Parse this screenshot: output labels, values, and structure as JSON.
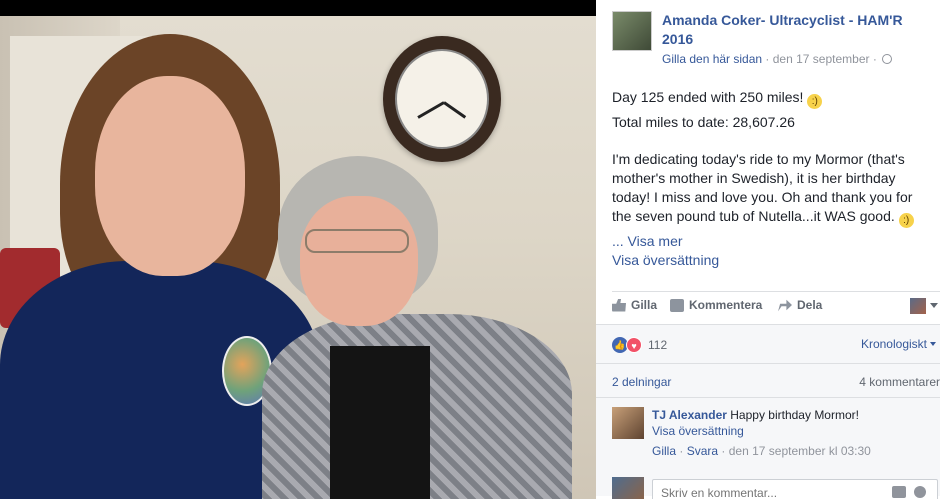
{
  "post": {
    "author": "Amanda Coker- Ultracyclist - HAM'R 2016",
    "like_page": "Gilla den här sidan",
    "date": "den 17 september",
    "separator": "·",
    "paragraph1": "Day 125 ended with 250 miles!",
    "paragraph2": "Total miles to date: 28,607.26",
    "paragraph3": "I'm dedicating today's ride to my Mormor (that's mother's mother in Swedish), it is her birthday today! I miss and love you. Oh and thank you for the seven pound tub of Nutella...it WAS good.",
    "see_more": "... Visa mer",
    "see_translation": "Visa översättning"
  },
  "actions": {
    "like": "Gilla",
    "comment": "Kommentera",
    "share": "Dela"
  },
  "stats": {
    "reactions_count": "112",
    "sort_label": "Kronologiskt",
    "shares": "2 delningar",
    "comments": "4 kommentarer"
  },
  "comment": {
    "name": "TJ Alexander",
    "text": "Happy birthday Mormor!",
    "translate": "Visa översättning",
    "like": "Gilla",
    "reply": "Svara",
    "timestamp": "den 17 september kl 03:30",
    "separator": "·"
  },
  "composer": {
    "placeholder": "Skriv en kommentar..."
  },
  "colors": {
    "link": "#365899",
    "like_reaction": "#4267b2",
    "love_reaction": "#f25268"
  }
}
